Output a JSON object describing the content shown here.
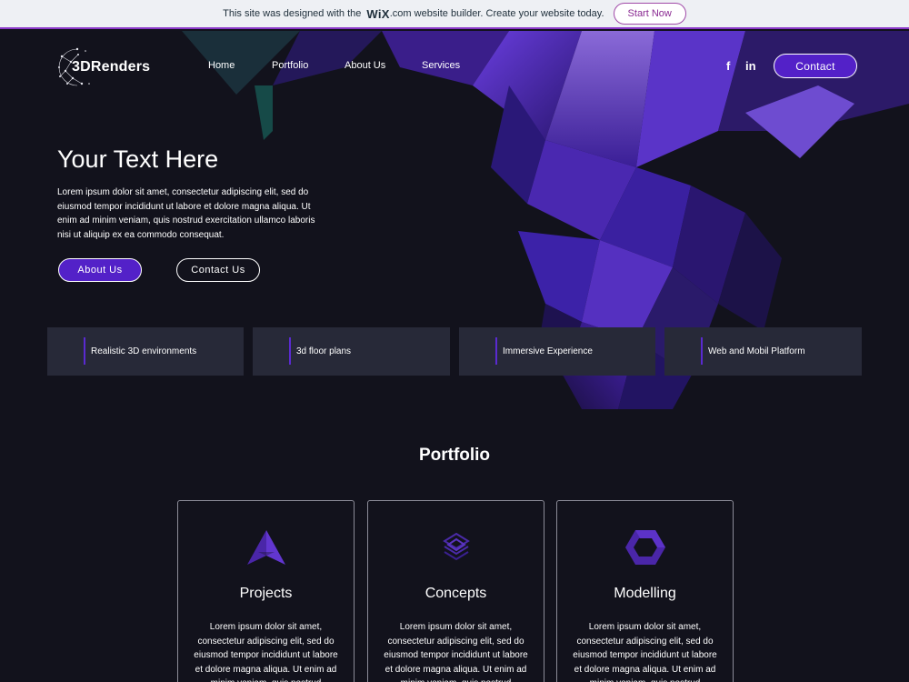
{
  "banner": {
    "prefix": "This site was designed with the",
    "brand": "WiX",
    "suffix": ".com website builder. Create your website today.",
    "cta": "Start Now"
  },
  "header": {
    "logo_text": "3DRenders",
    "nav": [
      "Home",
      "Portfolio",
      "About Us",
      "Services"
    ],
    "social": [
      "f",
      "in"
    ],
    "contact_label": "Contact"
  },
  "hero": {
    "title": "Your Text Here",
    "body": "Lorem ipsum dolor sit amet, consectetur adipiscing elit, sed do eiusmod tempor incididunt ut labore et dolore magna aliqua. Ut enim ad minim veniam, quis nostrud exercitation ullamco laboris nisi ut aliquip ex ea commodo consequat.",
    "buttons": [
      "About Us",
      "Contact Us"
    ]
  },
  "features": [
    "Realistic 3D environments",
    "3d floor plans",
    "Immersive Experience",
    "Web and Mobil Platform"
  ],
  "portfolio": {
    "title": "Portfolio",
    "cards": [
      {
        "title": "Projects",
        "icon": "triangle-logo-icon",
        "text": "Lorem ipsum dolor sit amet, consectetur adipiscing elit, sed do eiusmod tempor incididunt ut labore et dolore magna aliqua. Ut enim ad minim veniam, quis nostrud exercitation"
      },
      {
        "title": "Concepts",
        "icon": "layers-icon",
        "text": "Lorem ipsum dolor sit amet, consectetur adipiscing elit, sed do eiusmod tempor incididunt ut labore et dolore magna aliqua. Ut enim ad minim veniam, quis nostrud exercitation"
      },
      {
        "title": "Modelling",
        "icon": "hexagon-icon",
        "text": "Lorem ipsum dolor sit amet, consectetur adipiscing elit, sed do eiusmod tempor incididunt ut labore et dolore magna aliqua. Ut enim ad minim veniam, quis nostrud exercitation"
      }
    ]
  },
  "colors": {
    "accent": "#5321c8",
    "background": "#12121c",
    "feature_bg": "#272938",
    "banner_border": "#8a38c8"
  }
}
